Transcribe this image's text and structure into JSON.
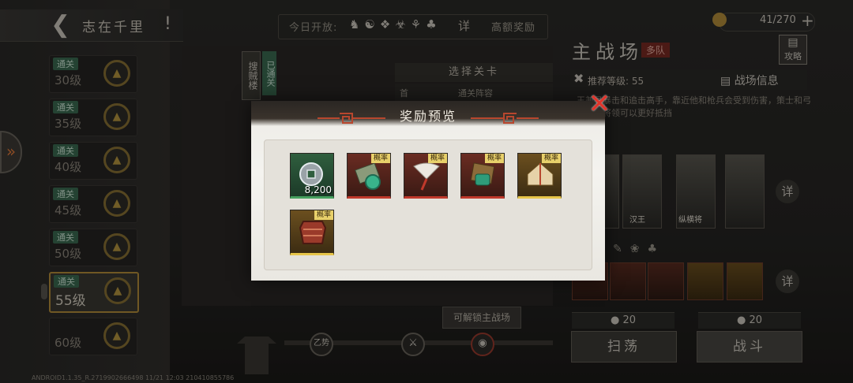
{
  "left_panel": {
    "title": "志在千里",
    "exclaim": "!",
    "levels": [
      {
        "badge": "通关",
        "label": "30级"
      },
      {
        "badge": "通关",
        "label": "35级"
      },
      {
        "badge": "通关",
        "label": "40级"
      },
      {
        "badge": "通关",
        "label": "45级"
      },
      {
        "badge": "通关",
        "label": "50级"
      },
      {
        "badge": "通关",
        "label": "55级"
      },
      {
        "badge": "",
        "label": "60级"
      }
    ]
  },
  "top_bar": {
    "today_label": "今日开放:",
    "detail": "详",
    "reward_link": "高额奖励"
  },
  "center": {
    "banner": "搜贼楼",
    "status": "已通关",
    "stage_header": "选择关卡",
    "stage_row": "首",
    "stage_row_text": "通关阵容",
    "unlock_button": "可解锁主战场",
    "node_label": "乙势"
  },
  "right_panel": {
    "title": "主战场",
    "multi_tag": "多队",
    "strategy": "攻略",
    "resource": "41/270",
    "recommended_level": "推荐等级: 55",
    "field_info": "战场信息",
    "desc": "王兼具暴击和追击高手，靠近他和枪兵会受到伤害，策士和弓箭系的将领可以更好抵挡",
    "detail_1": "详",
    "detail_2": "详",
    "hero_names": [
      "",
      "汉王",
      "纵横将",
      ""
    ],
    "cost_1": "20",
    "cost_2": "20",
    "sweep": "扫荡",
    "battle": "战斗"
  },
  "modal": {
    "title": "奖励预览",
    "items": [
      {
        "icon": "coin-icon",
        "rarity": "green",
        "prob": "",
        "qty": "8,200"
      },
      {
        "icon": "scroll-icon",
        "rarity": "red",
        "prob": "概率",
        "qty": ""
      },
      {
        "icon": "fan-icon",
        "rarity": "red",
        "prob": "概率",
        "qty": ""
      },
      {
        "icon": "tripod-icon",
        "rarity": "red",
        "prob": "概率",
        "qty": ""
      },
      {
        "icon": "tent-icon",
        "rarity": "gold",
        "prob": "概率",
        "qty": ""
      },
      {
        "icon": "armor-icon",
        "rarity": "gold",
        "prob": "概率",
        "qty": ""
      }
    ]
  },
  "footer": {
    "build": "ANDROID1.1.35_R.2719902666498 11/21 12:03 210410855786"
  }
}
